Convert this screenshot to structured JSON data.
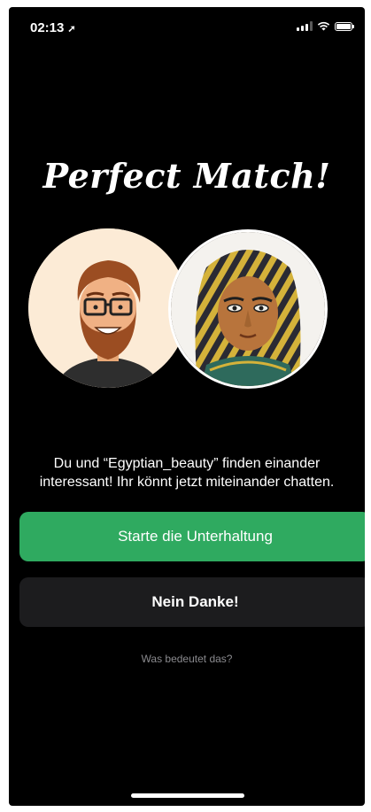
{
  "status_bar": {
    "time": "02:13",
    "location_icon": "location-arrow-icon",
    "signal_icon": "cellular-signal-icon",
    "wifi_icon": "wifi-icon",
    "battery_icon": "battery-icon"
  },
  "match": {
    "title": "Perfect Match!",
    "left_avatar": "cartoon-man-avatar",
    "right_avatar": "egyptian-mask-avatar",
    "message_line1": "Du und “Egyptian_beauty” finden einander",
    "message_line2": "interessant! Ihr könnt jetzt miteinander chatten."
  },
  "actions": {
    "start_chat_label": "Starte die Unterhaltung",
    "dismiss_label": "Nein Danke!",
    "help_link": "Was bedeutet das?"
  },
  "colors": {
    "background": "#000000",
    "primary_button": "#2faa60",
    "secondary_button": "#1c1c1e",
    "help_text": "#8a8a8e"
  }
}
